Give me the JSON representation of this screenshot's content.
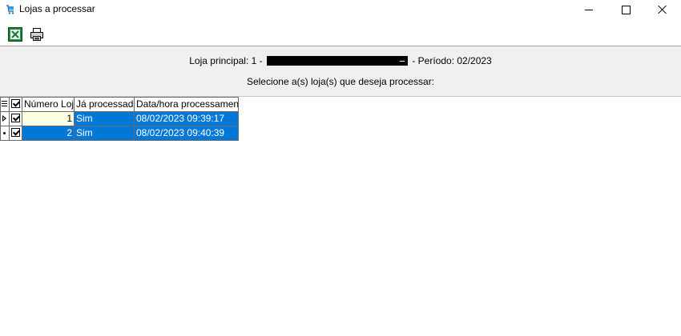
{
  "window": {
    "title": "Lojas a processar"
  },
  "toolbar": {
    "excel_icon": "excel-export-icon",
    "print_icon": "printer-icon"
  },
  "info": {
    "loja_label": "Loja principal: 1 -",
    "periodo": "-  Período: 02/2023",
    "instruction": "Selecione a(s) loja(s) que deseja processar:"
  },
  "grid": {
    "columns": [
      "Número Loja",
      "Já processada",
      "Data/hora processamento"
    ],
    "rows": [
      {
        "checked": true,
        "numero": "1",
        "processada": "Sim",
        "datahora": "08/02/2023 09:39:17"
      },
      {
        "checked": true,
        "numero": "2",
        "processada": "Sim",
        "datahora": "08/02/2023 09:40:39"
      }
    ]
  },
  "colors": {
    "selection": "#0078d7",
    "panel": "#f0f0f0"
  }
}
